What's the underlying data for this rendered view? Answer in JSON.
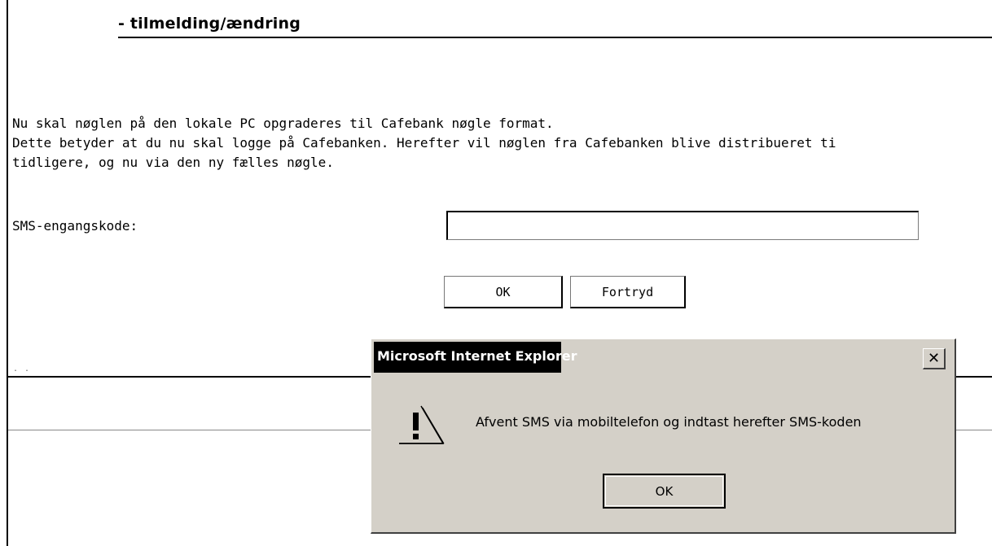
{
  "page": {
    "heading": "- tilmelding/ændring",
    "paragraph_lines": [
      "Nu skal nøglen på den lokale PC opgraderes til Cafebank nøgle format.",
      "Dette betyder at du nu skal logge på Cafebanken. Herefter vil nøglen fra Cafebanken blive distribueret ti",
      "tidligere, og nu via den ny fælles nøgle."
    ],
    "sms_label": "SMS-engangskode:",
    "sms_value": "",
    "ok_label": "OK",
    "cancel_label": "Fortryd",
    "footer_dots": ". ."
  },
  "dialog": {
    "title": "Microsoft Internet Explorer",
    "close_glyph": "✕",
    "icon": "warning-icon",
    "message": "Afvent SMS via mobiltelefon og indtast herefter SMS-koden",
    "ok_label": "OK"
  },
  "colors": {
    "dialog_bg": "#d4d0c8",
    "title_bar_bg": "#000000",
    "title_text": "#ffffff"
  }
}
